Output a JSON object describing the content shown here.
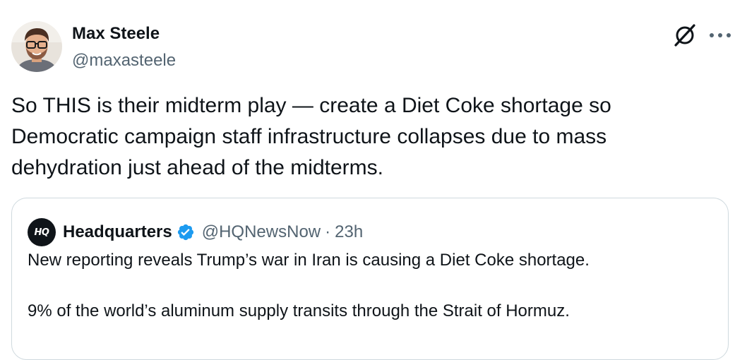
{
  "author": {
    "name": "Max Steele",
    "handle": "@maxasteele"
  },
  "tweet_text": "So THIS is their midterm play — create a Diet Coke shortage so Democratic campaign staff infrastructure collapses due to mass dehydration just ahead of the midterms.",
  "quoted_tweet": {
    "logo_text": "HQ",
    "name": "Headquarters",
    "handle": "@HQNewsNow",
    "separator": "·",
    "time": "23h",
    "paragraphs": [
      "New reporting reveals Trump’s war in Iran is causing a Diet Coke shortage.",
      "9% of the world’s aluminum supply transits through the Strait of Hormuz."
    ]
  },
  "icons": {
    "avatar": "user-avatar-photo",
    "grok": "grok-icon",
    "more": "more-horizontal-icon",
    "verified": "verified-badge-icon"
  },
  "colors": {
    "text": "#0f1419",
    "secondary": "#536471",
    "verified_blue": "#1d9bf0",
    "border": "#cfd9de"
  }
}
